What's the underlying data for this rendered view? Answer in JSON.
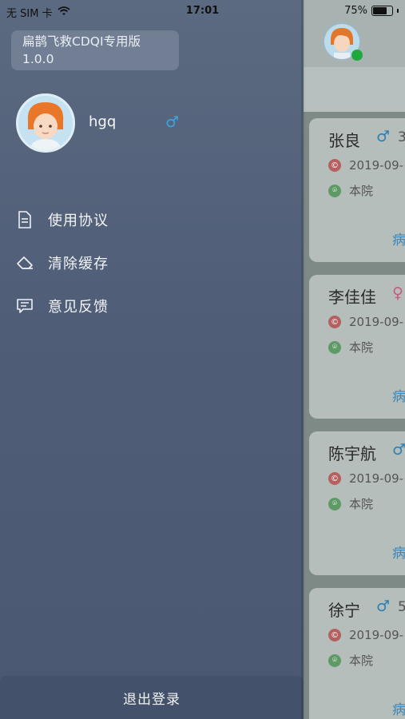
{
  "status_bar": {
    "carrier": "无 SIM 卡",
    "time": "17:01",
    "battery": "75%",
    "battery_level": 0.75
  },
  "drawer": {
    "app_title": "扁鹊飞救CDQI专用版",
    "app_version": "1.0.0",
    "user_name": "hgq",
    "user_gender": "♂",
    "menu": [
      {
        "label": "使用协议",
        "icon": "document-icon"
      },
      {
        "label": "清除缓存",
        "icon": "eraser-icon"
      },
      {
        "label": "意见反馈",
        "icon": "feedback-icon"
      }
    ],
    "logout_label": "退出登录"
  },
  "background_list": {
    "cards": [
      {
        "name": "张良",
        "gender": "♂",
        "age": "3",
        "date": "2019-09-",
        "location": "本院",
        "link": "病"
      },
      {
        "name": "李佳佳",
        "gender": "♀",
        "age": "",
        "date": "2019-09-",
        "location": "本院",
        "link": "病"
      },
      {
        "name": "陈宇航",
        "gender": "♂",
        "age": "",
        "date": "2019-09-",
        "location": "本院",
        "link": "病"
      },
      {
        "name": "徐宁",
        "gender": "♂",
        "age": "5",
        "date": "2019-09-",
        "location": "本院",
        "link": "病"
      }
    ]
  },
  "colors": {
    "drawer_bg": "#4f5d77",
    "gender_male": "#3ba3e0",
    "online": "#1fa83b"
  }
}
